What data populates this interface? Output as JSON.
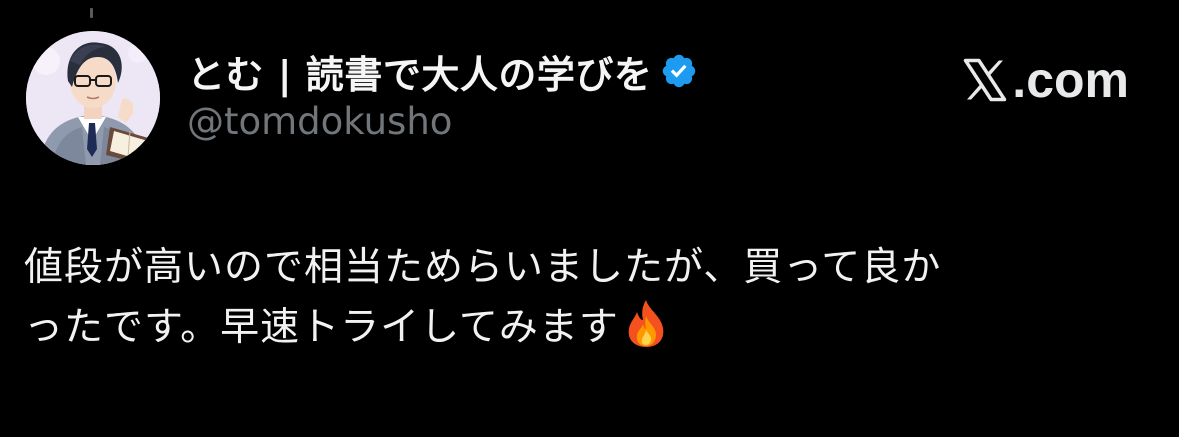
{
  "author": {
    "display_name": "とむ | 読書で大人の学びを",
    "handle": "@tomdokusho",
    "verified_icon": "verified-badge-icon",
    "avatar_icon": "avatar"
  },
  "brand": {
    "icon": "x-logo-icon",
    "text": ".com"
  },
  "tweet": {
    "line1": "値段が高いので相当ためらいましたが、買って良か",
    "line2": "ったです。早速トライしてみます",
    "emoji_icon": "fire-icon"
  },
  "colors": {
    "background": "#000000",
    "text": "#f2f2f2",
    "handle": "#71767b",
    "verified": "#1d9bf0"
  }
}
